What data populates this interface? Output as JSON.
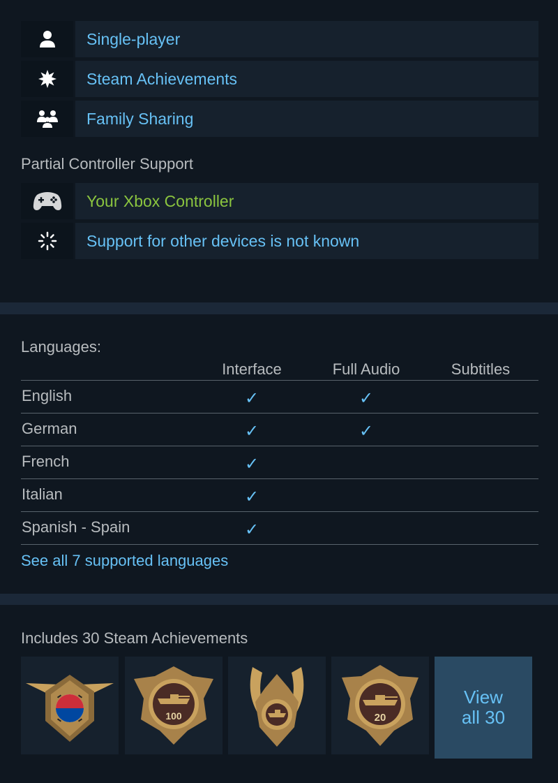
{
  "features": [
    {
      "label": "Single-player",
      "icon": "single-player-icon"
    },
    {
      "label": "Steam Achievements",
      "icon": "achievement-star-icon"
    },
    {
      "label": "Family Sharing",
      "icon": "family-sharing-icon"
    }
  ],
  "controller": {
    "heading": "Partial Controller Support",
    "items": [
      {
        "label": "Your Xbox Controller",
        "icon": "gamepad-icon"
      },
      {
        "label": "Support for other devices is not known",
        "icon": "loading-spinner-icon"
      }
    ]
  },
  "languages": {
    "heading": "Languages:",
    "columns": [
      "Interface",
      "Full Audio",
      "Subtitles"
    ],
    "check_glyph": "✓",
    "rows": [
      {
        "name": "English",
        "interface": true,
        "audio": true,
        "subtitles": false
      },
      {
        "name": "German",
        "interface": true,
        "audio": true,
        "subtitles": false
      },
      {
        "name": "French",
        "interface": true,
        "audio": false,
        "subtitles": false
      },
      {
        "name": "Italian",
        "interface": true,
        "audio": false,
        "subtitles": false
      },
      {
        "name": "Spanish - Spain",
        "interface": true,
        "audio": false,
        "subtitles": false
      }
    ],
    "see_all": "See all 7 supported languages"
  },
  "achievements": {
    "heading": "Includes 30 Steam Achievements",
    "badges": [
      {
        "icon": "korea-flag-badge-icon"
      },
      {
        "icon": "tank-100-badge-icon",
        "text": "100"
      },
      {
        "icon": "tank-wreath-badge-icon"
      },
      {
        "icon": "tank-20-badge-icon",
        "text": "20"
      }
    ],
    "view_all_line1": "View",
    "view_all_line2": "all 30"
  },
  "colors": {
    "background": "#0f1720",
    "panel": "#16212d",
    "link": "#67c1f5",
    "green": "#8bc53f",
    "text": "#b8bcbf",
    "badge_gold": "#c9a25e"
  }
}
